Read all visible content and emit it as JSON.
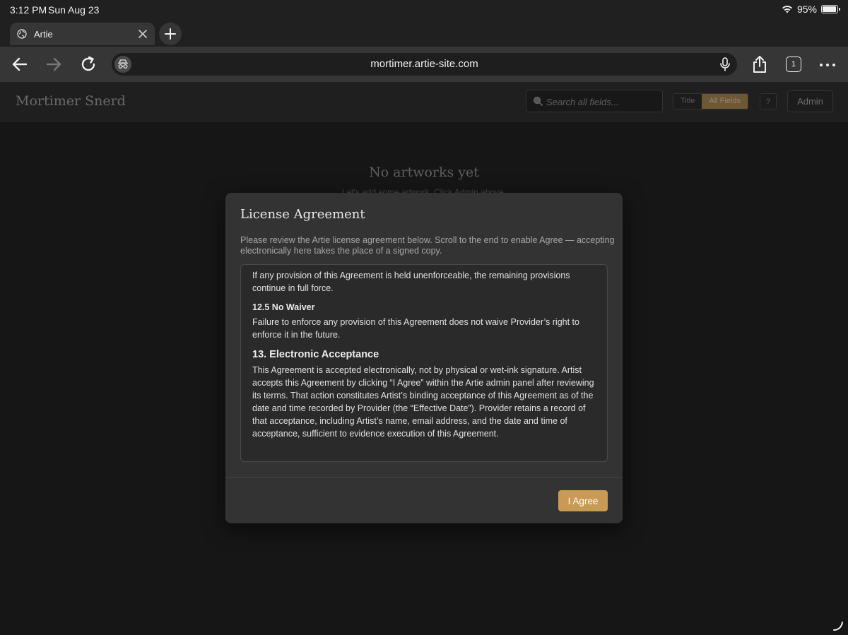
{
  "status_bar": {
    "time": "3:12 PM",
    "date": "Sun Aug 23",
    "battery": "95%",
    "battery_level": 0.95
  },
  "browser": {
    "tab_title": "Artie",
    "url": "mortimer.artie-site.com",
    "tab_count": "1"
  },
  "site": {
    "title": "Mortimer Snerd",
    "search_placeholder": "Search all fields...",
    "filter_title": "Title",
    "filter_all": "All Fields",
    "help_label": "?",
    "admin_label": "Admin"
  },
  "empty_state": {
    "title": "No artworks yet",
    "subtitle": "Let's add some artwork. Click Admin above."
  },
  "modal": {
    "title": "License Agreement",
    "intro": "Please review the Artie license agreement below. Scroll to the end to enable Agree — accepting electronically here takes the place of a signed copy.",
    "sections": {
      "p_12_4": "If any provision of this Agreement is held unenforceable, the remaining provisions continue in full force.",
      "h_12_5": "12.5 No Waiver",
      "p_12_5": "Failure to enforce any provision of this Agreement does not waive Provider’s right to enforce it in the future.",
      "h_13": "13. Electronic Acceptance",
      "p_13": "This Agreement is accepted electronically, not by physical or wet-ink signature. Artist accepts this Agreement by clicking “I Agree” within the Artie admin panel after reviewing its terms. That action constitutes Artist’s binding acceptance of this Agreement as of the date and time recorded by Provider (the “Effective Date”). Provider retains a record of that acceptance, including Artist’s name, email address, and the date and time of acceptance, sufficient to evidence execution of this Agreement."
    },
    "agree_label": "I Agree",
    "accent_color": "#c99a54"
  }
}
